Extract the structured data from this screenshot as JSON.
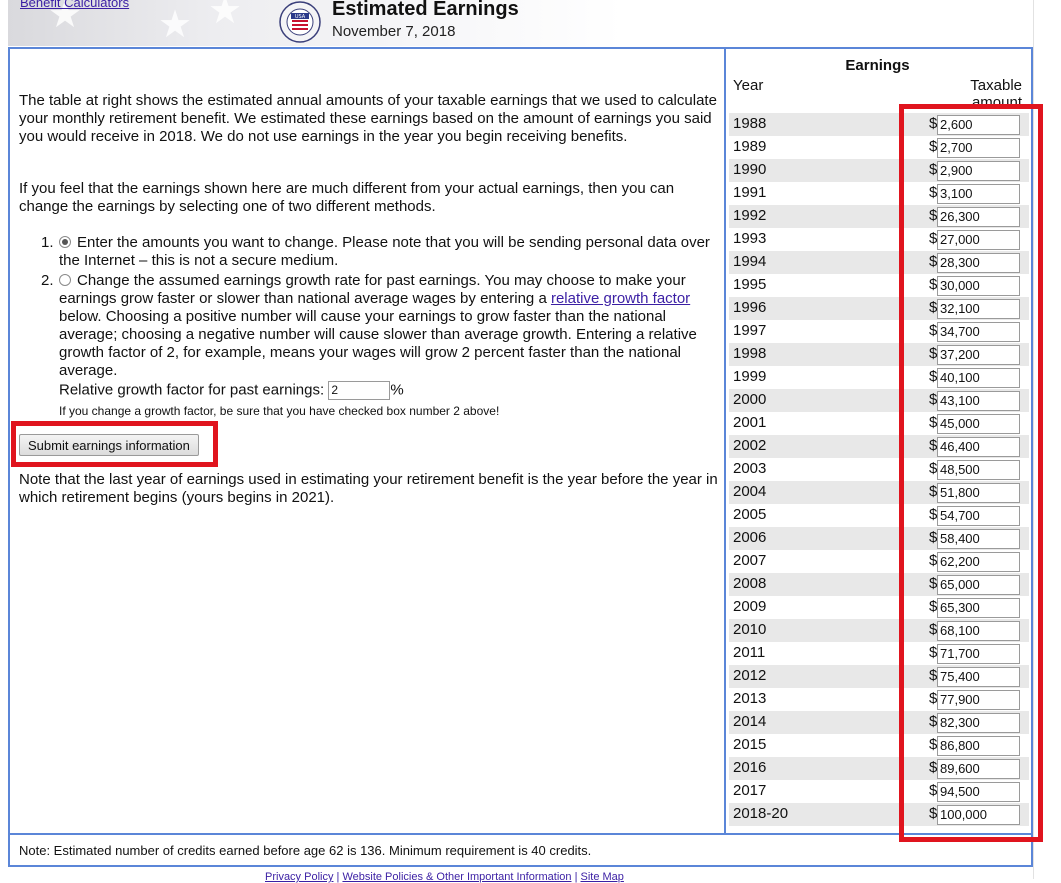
{
  "header": {
    "benefit_link": "Benefit Calculators",
    "title": "Estimated Earnings",
    "date": "November 7, 2018",
    "logo_icon": "ssa-seal-icon"
  },
  "left": {
    "para1": "The table at right shows the estimated annual amounts of your taxable earnings that we used to calculate your monthly retirement benefit. We estimated these earnings based on the amount of earnings you said you would receive in 2018. We do not use earnings in the year you begin receiving benefits.",
    "para2": "If you feel that the earnings shown here are much different from your actual earnings, then you can change the earnings by selecting one of two different methods.",
    "option1_num": "1.",
    "option1_text": "Enter the amounts you want to change. Please note that you will be sending personal data over the Internet – this is not a secure medium.",
    "option2_num": "2.",
    "option2_text_a": "Change the assumed earnings growth rate for past earnings. You may choose to make your earnings grow faster or slower than national average wages by entering a ",
    "option2_link": "relative growth factor",
    "option2_text_b": " below. Choosing a positive number will cause your earnings to grow faster than the national average; choosing a negative number will cause slower than average growth. Entering a relative growth factor of 2, for example, means your wages will grow 2 percent faster than the national average.",
    "growth_label": "Relative growth factor for past earnings:",
    "growth_value": "2",
    "growth_unit": "%",
    "growth_note": "If you change a growth factor, be sure that you have checked box number 2 above!",
    "submit_label": "Submit earnings information",
    "para3": "Note that the last year of earnings used in estimating your retirement benefit is the year before the year in which retirement begins (yours begins in 2021)."
  },
  "earnings": {
    "title": "Earnings",
    "col_year": "Year",
    "col_amount": "Taxable amount",
    "currency": "$",
    "rows": [
      {
        "year": "1988",
        "amount": "2,600"
      },
      {
        "year": "1989",
        "amount": "2,700"
      },
      {
        "year": "1990",
        "amount": "2,900"
      },
      {
        "year": "1991",
        "amount": "3,100"
      },
      {
        "year": "1992",
        "amount": "26,300"
      },
      {
        "year": "1993",
        "amount": "27,000"
      },
      {
        "year": "1994",
        "amount": "28,300"
      },
      {
        "year": "1995",
        "amount": "30,000"
      },
      {
        "year": "1996",
        "amount": "32,100"
      },
      {
        "year": "1997",
        "amount": "34,700"
      },
      {
        "year": "1998",
        "amount": "37,200"
      },
      {
        "year": "1999",
        "amount": "40,100"
      },
      {
        "year": "2000",
        "amount": "43,100"
      },
      {
        "year": "2001",
        "amount": "45,000"
      },
      {
        "year": "2002",
        "amount": "46,400"
      },
      {
        "year": "2003",
        "amount": "48,500"
      },
      {
        "year": "2004",
        "amount": "51,800"
      },
      {
        "year": "2005",
        "amount": "54,700"
      },
      {
        "year": "2006",
        "amount": "58,400"
      },
      {
        "year": "2007",
        "amount": "62,200"
      },
      {
        "year": "2008",
        "amount": "65,000"
      },
      {
        "year": "2009",
        "amount": "65,300"
      },
      {
        "year": "2010",
        "amount": "68,100"
      },
      {
        "year": "2011",
        "amount": "71,700"
      },
      {
        "year": "2012",
        "amount": "75,400"
      },
      {
        "year": "2013",
        "amount": "77,900"
      },
      {
        "year": "2014",
        "amount": "82,300"
      },
      {
        "year": "2015",
        "amount": "86,800"
      },
      {
        "year": "2016",
        "amount": "89,600"
      },
      {
        "year": "2017",
        "amount": "94,500"
      },
      {
        "year": "2018-20",
        "amount": "100,000"
      }
    ]
  },
  "bottom_note": "Note: Estimated number of credits earned before age 62 is 136. Minimum requirement is 40 credits.",
  "footer": {
    "privacy": "Privacy Policy",
    "policies": "Website Policies & Other Important Information",
    "sitemap": "Site Map",
    "sep": "|"
  },
  "annotation_color": "#e0141e",
  "border_color": "#5b86d8"
}
